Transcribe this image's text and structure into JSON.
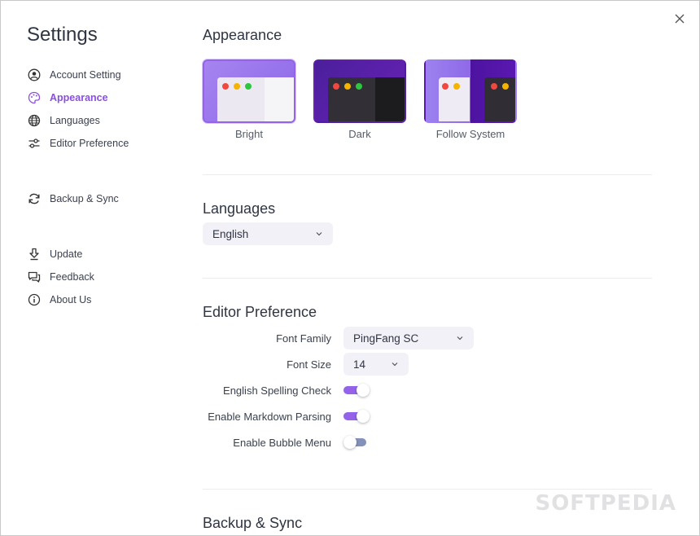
{
  "sidebar": {
    "title": "Settings",
    "items": [
      {
        "label": "Account Setting",
        "icon": "user-circle-icon",
        "active": false
      },
      {
        "label": "Appearance",
        "icon": "palette-icon",
        "active": true
      },
      {
        "label": "Languages",
        "icon": "globe-icon",
        "active": false
      },
      {
        "label": "Editor Preference",
        "icon": "sliders-icon",
        "active": false
      },
      {
        "label": "Backup & Sync",
        "icon": "sync-icon",
        "active": false
      },
      {
        "label": "Update",
        "icon": "download-icon",
        "active": false
      },
      {
        "label": "Feedback",
        "icon": "chat-icon",
        "active": false
      },
      {
        "label": "About Us",
        "icon": "info-icon",
        "active": false
      }
    ]
  },
  "appearance": {
    "title": "Appearance",
    "themes": [
      {
        "label": "Bright",
        "selected": true
      },
      {
        "label": "Dark",
        "selected": false
      },
      {
        "label": "Follow System",
        "selected": false
      }
    ]
  },
  "languages": {
    "title": "Languages",
    "selected": "English"
  },
  "editor": {
    "title": "Editor Preference",
    "font_family_label": "Font Family",
    "font_family_value": "PingFang SC",
    "font_size_label": "Font Size",
    "font_size_value": "14",
    "spelling_label": "English Spelling Check",
    "spelling_on": true,
    "markdown_label": "Enable Markdown Parsing",
    "markdown_on": true,
    "bubble_label": "Enable Bubble Menu",
    "bubble_on": false
  },
  "backup": {
    "title": "Backup & Sync"
  },
  "watermark": "SOFTPEDIA",
  "colors": {
    "accent": "#9463ea",
    "active_nav": "#8a4fe0",
    "toggle_off": "#8491b8",
    "dot_red": "#f0473f",
    "dot_yellow": "#f5b400",
    "dot_green": "#2dc63f"
  }
}
